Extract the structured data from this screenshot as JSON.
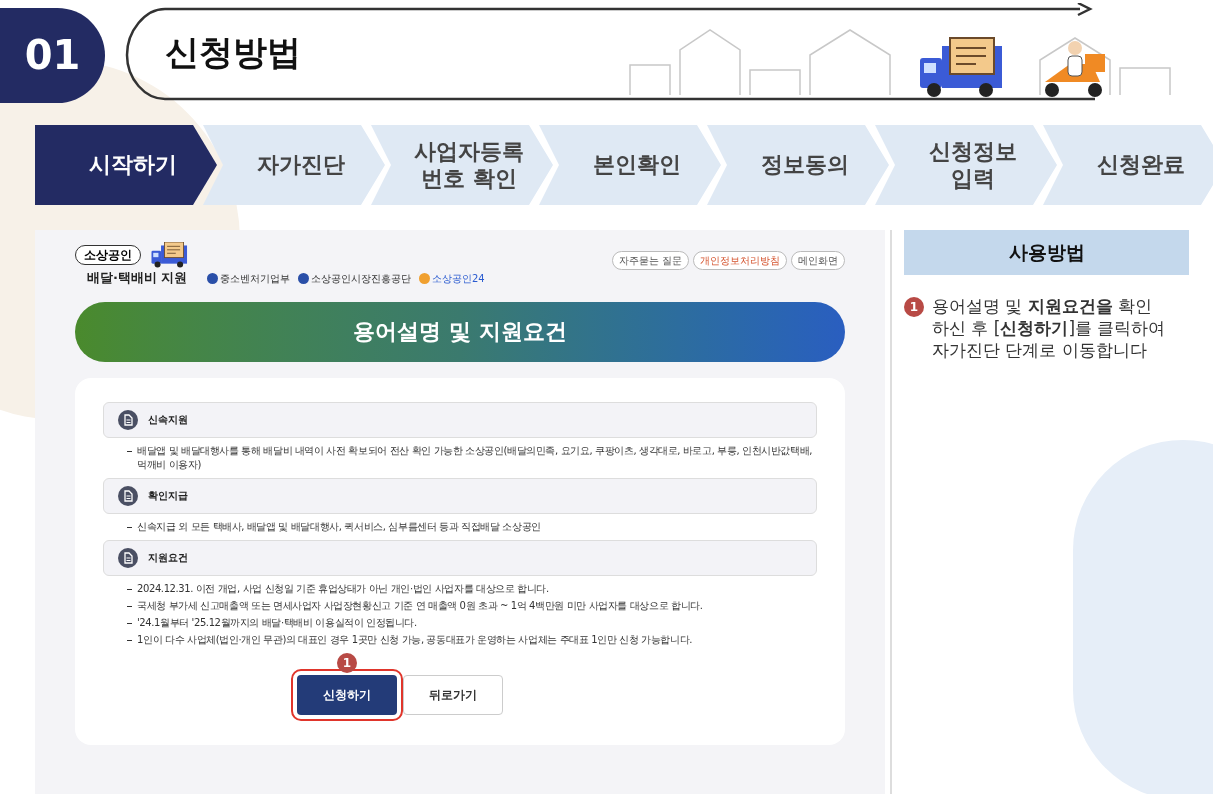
{
  "header": {
    "number": "01",
    "title": "신청방법"
  },
  "steps": [
    {
      "label": "시작하기",
      "selected": true
    },
    {
      "label": "자가진단",
      "selected": false
    },
    {
      "label": "사업자등록\n번호 확인",
      "selected": false
    },
    {
      "label": "본인확인",
      "selected": false
    },
    {
      "label": "정보동의",
      "selected": false
    },
    {
      "label": "신청정보\n입력",
      "selected": false
    },
    {
      "label": "신청완료",
      "selected": false
    }
  ],
  "screen": {
    "logo": {
      "badge": "소상공인",
      "title": "배달·택배비 지원"
    },
    "agencies": [
      "중소벤처기업부",
      "소상공인시장진흥공단",
      "소상공인24"
    ],
    "top_links": [
      {
        "label": "자주묻는 질문",
        "kind": "plain"
      },
      {
        "label": "개인정보처리방침",
        "kind": "accent"
      },
      {
        "label": "메인화면",
        "kind": "plain"
      }
    ],
    "banner": "용어설명 및 지원요건",
    "sections": [
      {
        "title": "신속지원",
        "items": [
          "배달앱 및 배달대행사를 통해 배달비 내역이 사전 확보되어 전산 확인 가능한 소상공인(배달의민족, 요기요, 쿠팡이츠, 생각대로, 바로고, 부릉, 인천시반값택배, 먹깨비 이용자)"
        ]
      },
      {
        "title": "확인지급",
        "items": [
          "신속지급 외 모든 택배사, 배달앱 및 배달대행사, 퀵서비스, 심부름센터 등과 직접배달 소상공인"
        ]
      },
      {
        "title": "지원요건",
        "items": [
          "2024.12.31. 이전 개업, 사업 신청일 기준 휴업상태가 아닌 개인·법인 사업자를 대상으로 합니다.",
          "국세청 부가세 신고매출액 또는 면세사업자 사업장현황신고 기준 연 매출액 0원 초과 ~ 1억 4백만원 미만 사업자를 대상으로 합니다.",
          "'24.1월부터 '25.12월까지의 배달·택배비 이용실적이 인정됩니다.",
          "1인이 다수 사업체(법인·개인 무관)의 대표인 경우 1곳만 신청 가능, 공동대표가 운영하는 사업체는 주대표 1인만 신청 가능합니다."
        ]
      }
    ],
    "buttons": [
      {
        "label": "신청하기",
        "kind": "primary",
        "highlighted": true,
        "badge": "1"
      },
      {
        "label": "뒤로가기",
        "kind": "secondary",
        "highlighted": false
      }
    ]
  },
  "guide": {
    "title": "사용방법",
    "steps": [
      {
        "number": "1",
        "text": "용어설명 및 **지원요건을** 확인하신 후 [**신청하기**]를 클릭하여 자가진단 단계로 이동합니다"
      }
    ]
  }
}
